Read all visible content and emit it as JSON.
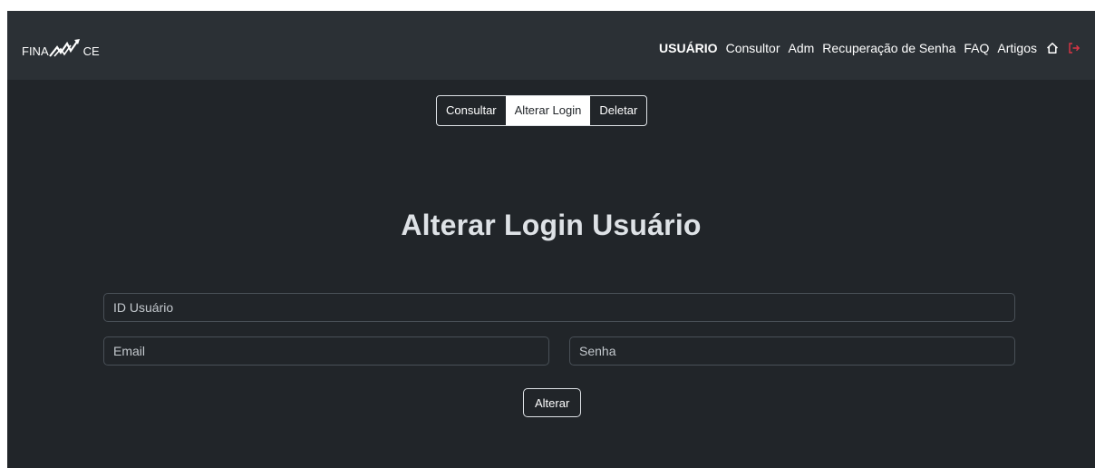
{
  "header": {
    "logo_text_left": "FINA",
    "logo_text_right": "CE",
    "nav": [
      {
        "label": "USUÁRIO",
        "active": true
      },
      {
        "label": "Consultor"
      },
      {
        "label": "Adm"
      },
      {
        "label": "Recuperação de Senha"
      },
      {
        "label": "FAQ"
      },
      {
        "label": "Artigos"
      }
    ],
    "icons": [
      "home-icon",
      "logout-icon"
    ],
    "logout_color": "#dc3545"
  },
  "tabs": [
    {
      "label": "Consultar"
    },
    {
      "label": "Alterar Login",
      "active": true
    },
    {
      "label": "Deletar"
    }
  ],
  "main": {
    "title": "Alterar Login Usuário",
    "fields": {
      "id_placeholder": "ID Usuário",
      "email_placeholder": "Email",
      "senha_placeholder": "Senha"
    },
    "submit_label": "Alterar"
  },
  "colors": {
    "background": "#212529",
    "navbar": "#2b3035"
  }
}
